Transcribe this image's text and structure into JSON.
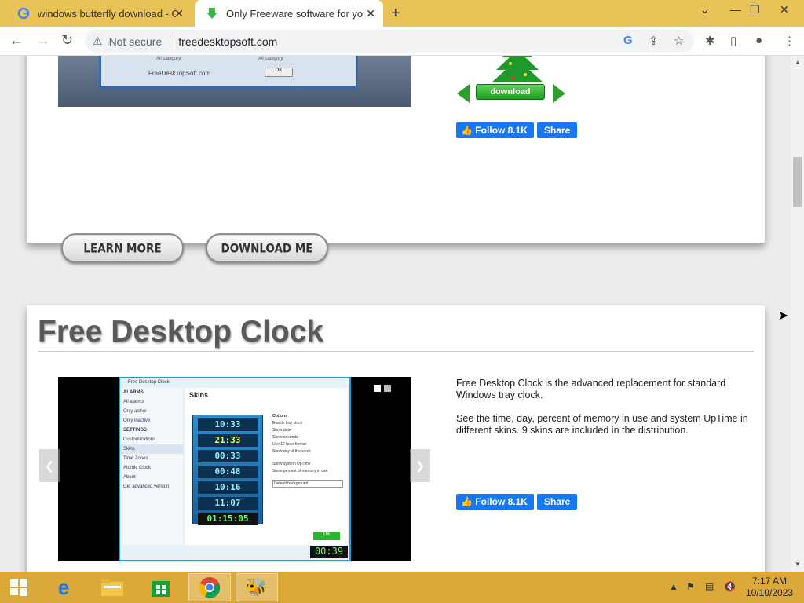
{
  "browser": {
    "tabs": [
      {
        "title": "windows butterfly download - G",
        "active": false
      },
      {
        "title": "Only Freeware software for your",
        "active": true
      }
    ],
    "new_tab": "+",
    "security_label": "Not secure",
    "url": "freedesktopsoft.com"
  },
  "section1": {
    "screenshot_caption": "FreeDeskTopSoft.com",
    "screenshot_cats": [
      "All category",
      "All category"
    ],
    "screenshot_ok": "OK",
    "download_badge": "download",
    "fb_follow": "Follow 8.1K",
    "fb_share": "Share",
    "learn_more": "LEARN MORE",
    "download_me": "DOWNLOAD ME"
  },
  "section2": {
    "title": "Free Desktop Clock",
    "app_window_title": "Free Desktop Clock",
    "app_panel_title": "Skins",
    "app_sidebar": [
      "ALARMS",
      "All alarms",
      "Only active",
      "Only inactive",
      "SETTINGS",
      "Customizations",
      "Skins",
      "Time Zones",
      "Atomic Clock",
      "About",
      "Get advanced version"
    ],
    "app_options": [
      "Options",
      "Enable tray clock",
      "Show date",
      "Show seconds",
      "Use 12 hour format",
      "Show day of the week",
      "Show system UpTime",
      "Show percent of memory in use",
      "Default background"
    ],
    "clock_faces": [
      "10:33",
      "21:33",
      "00:33",
      "00:48",
      "10:16",
      "11:07",
      "01:15:05"
    ],
    "app_ok": "OK",
    "tray_clock": "00:39",
    "description": [
      "Free Desktop Clock is the advanced replacement for standard Windows tray clock.",
      "See the time, day, percent of memory in use and system UpTime in different skins. 9 skins are included in the distribution."
    ],
    "fb_follow": "Follow 8.1K",
    "fb_share": "Share"
  },
  "taskbar": {
    "time": "7:17 AM",
    "date": "10/10/2023"
  },
  "colors": {
    "tabbar": "#e9c258",
    "taskbar": "#dba93a",
    "facebook": "#1877f2",
    "download_green": "#2aa02a"
  }
}
